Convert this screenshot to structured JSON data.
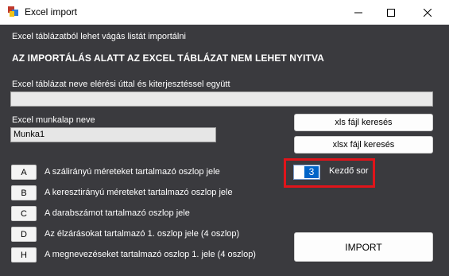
{
  "window": {
    "title": "Excel import",
    "controls": {
      "minimize": "minimize-icon",
      "maximize": "maximize-icon",
      "close": "close-icon"
    }
  },
  "intro_text": "Excel táblázatból lehet vágás listát importálni",
  "warning_text": "AZ IMPORTÁLÁS ALATT AZ EXCEL TÁBLÁZAT NEM LEHET NYITVA",
  "path": {
    "label": "Excel táblázat neve elérési úttal és kiterjesztéssel együtt",
    "value": ""
  },
  "sheet": {
    "label": "Excel munkalap neve",
    "value": "Munka1"
  },
  "search_buttons": {
    "xls": "xls  fájl keresés",
    "xlsx": "xlsx  fájl keresés"
  },
  "start_row": {
    "value": "3",
    "label": "Kezdő sor"
  },
  "columns": [
    {
      "letter": "A",
      "label": "A szálirányú méreteket tartalmazó oszlop jele"
    },
    {
      "letter": "B",
      "label": "A keresztirányú méreteket tartalmazó oszlop jele"
    },
    {
      "letter": "C",
      "label": "A darabszámot tartalmazó oszlop jele"
    },
    {
      "letter": "D",
      "label": "Az élzárásokat tartalmazó 1. oszlop jele (4 oszlop)"
    },
    {
      "letter": "H",
      "label": "A megnevezéseket tartalmazó oszlop 1. jele (4 oszlop)"
    }
  ],
  "import_button": "IMPORT",
  "colors": {
    "background": "#3a3a3e",
    "highlight": "#e0141a",
    "selection": "#0064c8"
  }
}
